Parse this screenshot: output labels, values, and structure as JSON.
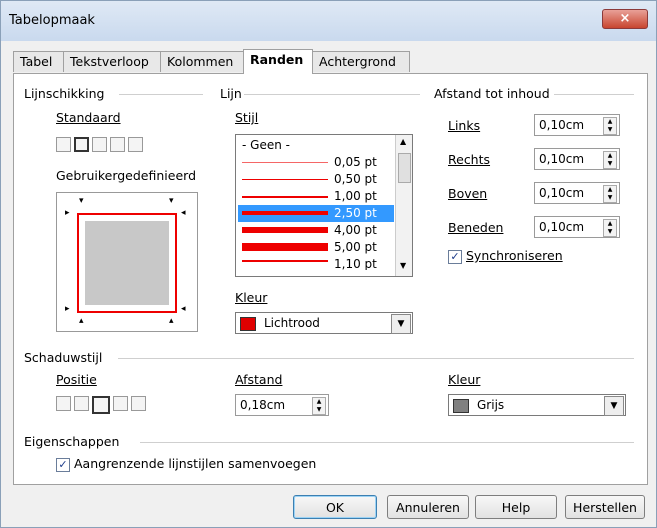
{
  "window": {
    "title": "Tabelopmaak",
    "close_glyph": "×"
  },
  "tabs": [
    {
      "label": "Tabel"
    },
    {
      "label": "Tekstverloop"
    },
    {
      "label": "Kolommen"
    },
    {
      "label": "Randen",
      "active": true
    },
    {
      "label": "Achtergrond"
    }
  ],
  "line_arrangement": {
    "title": "Lijnschikking",
    "standard_label": "Standaard",
    "custom_label": "Gebruikergedefinieerd"
  },
  "line": {
    "title": "Lijn",
    "style_label": "Stijl",
    "styles": [
      "- Geen -",
      "0,05 pt",
      "0,50 pt",
      "1,00 pt",
      "2,50 pt",
      "4,00 pt",
      "5,00 pt",
      "1,10 pt"
    ],
    "selected_style": "2,50 pt",
    "color_label": "Kleur",
    "color_value": "Lichtrood",
    "color_hex": "#e00000"
  },
  "spacing": {
    "title": "Afstand tot inhoud",
    "fields": [
      {
        "label": "Links",
        "value": "0,10cm"
      },
      {
        "label": "Rechts",
        "value": "0,10cm"
      },
      {
        "label": "Boven",
        "value": "0,10cm"
      },
      {
        "label": "Beneden",
        "value": "0,10cm"
      }
    ],
    "sync_label": "Synchroniseren",
    "sync_checked": true
  },
  "shadow": {
    "title": "Schaduwstijl",
    "position_label": "Positie",
    "distance_label": "Afstand",
    "distance_value": "0,18cm",
    "color_label": "Kleur",
    "color_value": "Grijs",
    "color_hex": "#808080"
  },
  "properties": {
    "title": "Eigenschappen",
    "merge_label": "Aangrenzende lijnstijlen samenvoegen",
    "merge_checked": true
  },
  "buttons": {
    "ok": "OK",
    "cancel": "Annuleren",
    "help": "Help",
    "reset": "Herstellen"
  }
}
